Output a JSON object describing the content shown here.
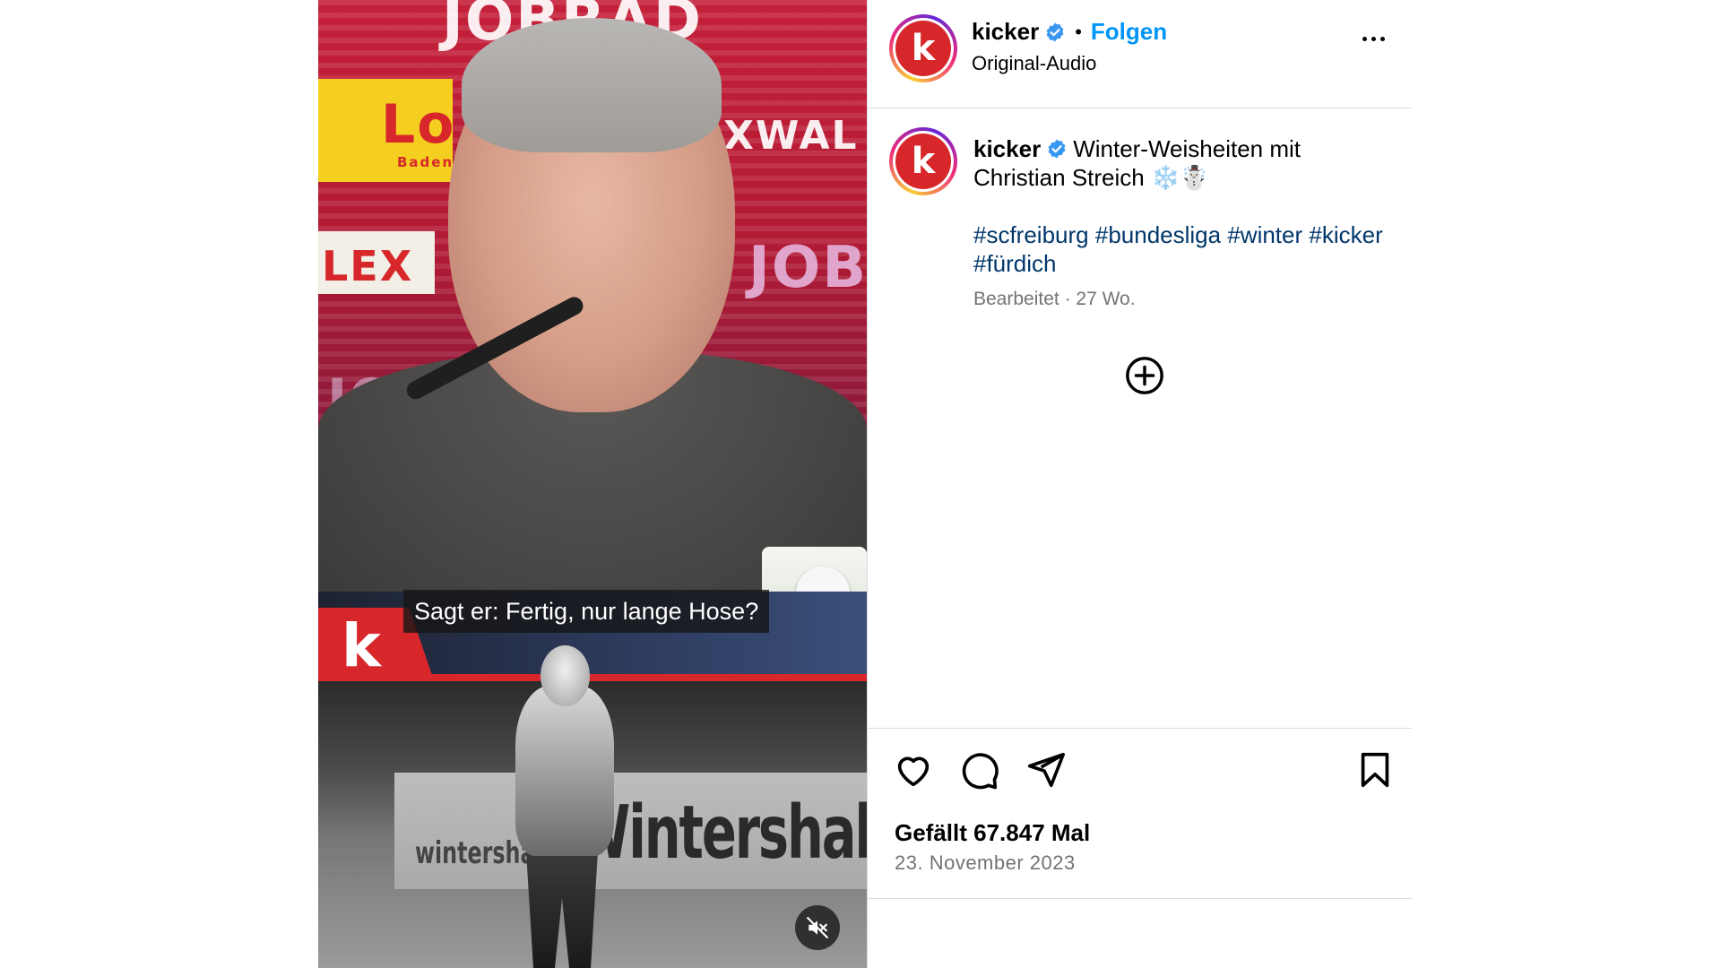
{
  "video": {
    "ad_texts": [
      "JOBRAD",
      "Lo",
      "Baden",
      "LEX",
      "XWAL",
      "JOBRA",
      "JO"
    ],
    "subtitle": "Sagt er: Fertig, nur lange Hose?",
    "logo_letter": "k",
    "archive_banner": "Wintershall",
    "archive_banner_small": "wintershall",
    "mute_icon": "speaker-muted-icon"
  },
  "post": {
    "username": "kicker",
    "verified": true,
    "separator": "•",
    "follow_label": "Folgen",
    "audio_label": "Original-Audio",
    "avatar_letter": "k",
    "caption_text": "Winter-Weisheiten mit Christian Streich ❄️☃️",
    "hashtags": [
      "#scfreiburg",
      "#bundesliga",
      "#winter",
      "#kicker",
      "#fürdich"
    ],
    "edited_label": "Bearbeitet",
    "age": "27 Wo.",
    "meta_separator": " · ",
    "likes": "Gefällt 67.847 Mal",
    "date": "23. November 2023"
  },
  "icons": {
    "like": "heart-icon",
    "comment": "comment-bubble-icon",
    "share": "paper-plane-icon",
    "save": "bookmark-icon",
    "more": "more-dots-icon",
    "load_comments": "plus-circle-icon",
    "verified": "verified-badge-icon"
  },
  "colors": {
    "accent": "#0095f6",
    "hashtag": "#00376b",
    "muted": "#737373",
    "brand_red": "#d7272b",
    "divider": "#dbdbdb"
  }
}
